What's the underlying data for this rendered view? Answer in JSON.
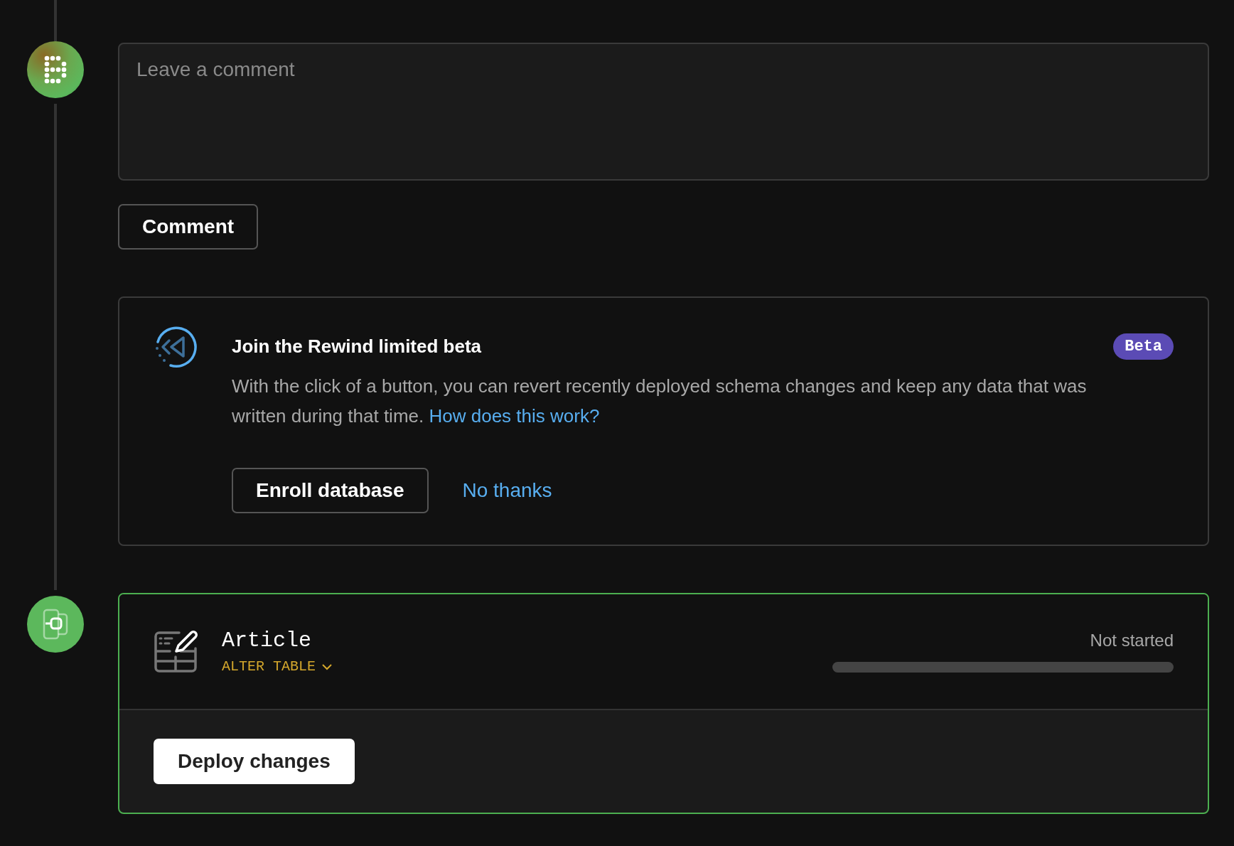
{
  "comment_box": {
    "placeholder": "Leave a comment"
  },
  "comment_button": "Comment",
  "beta_card": {
    "title": "Join the Rewind limited beta",
    "badge": "Beta",
    "text": "With the click of a button, you can revert recently deployed schema changes and keep any data that was written during that time.",
    "link": "How does this work?",
    "enroll_button": "Enroll database",
    "dismiss_link": "No thanks"
  },
  "deploy_card": {
    "table": "Article",
    "operation": "ALTER TABLE",
    "status": "Not started",
    "progress": {
      "level": 0
    },
    "deploy_button": "Deploy changes"
  }
}
